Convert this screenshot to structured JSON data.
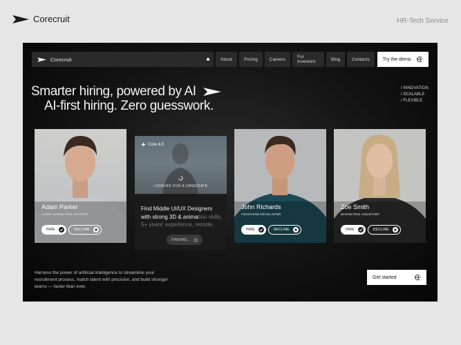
{
  "outer": {
    "brand": "Corecruit",
    "tagline": "HR-Tech Service"
  },
  "nav": {
    "brand": "Corecruit",
    "links": [
      "About",
      "Pricing",
      "Careers",
      "For Investors",
      "Blog",
      "Contacts"
    ],
    "cta": "Try the demo"
  },
  "hero": {
    "line1": "Smarter hiring, powered by AI",
    "line2": "AI-first hiring. Zero guesswork.",
    "tags": [
      "/ INNOVATION",
      "/ SCALABLE",
      "/ FLEXIBLE"
    ]
  },
  "cards": [
    {
      "name": "Adam Parker",
      "role": "CHIEF MARKETING OFFICER",
      "hire": "HIRE",
      "decline": "DECLINE"
    },
    {
      "name": "John Richards",
      "role": "FRONTEND DEVELOPER",
      "hire": "HIRE",
      "decline": "DECLINE"
    },
    {
      "name": "Zoe Smith",
      "role": "MARKETING ASSISTANT",
      "hire": "HIRE",
      "decline": "DECLINE"
    }
  ],
  "search_card": {
    "badge": "Core 4.0",
    "status": "LOOKING FOR A CANDIDATE",
    "desc_strong": "Find Middle UI/UX Designers with strong 3D & anima",
    "desc_fade": "tion skills, 5+ years' experience, remote.",
    "button": "FINDING..."
  },
  "footer": {
    "description": "Harness the power of artificial intelligence to streamline your recruitment process, match talent with precision, and build stronger teams — faster than ever.",
    "cta": "Get started"
  },
  "colors": {
    "frame_bg": "#0d0d0d",
    "page_bg": "#e6e6e6",
    "nav_bg": "#2a2a2a",
    "accent": "#ffffff"
  }
}
